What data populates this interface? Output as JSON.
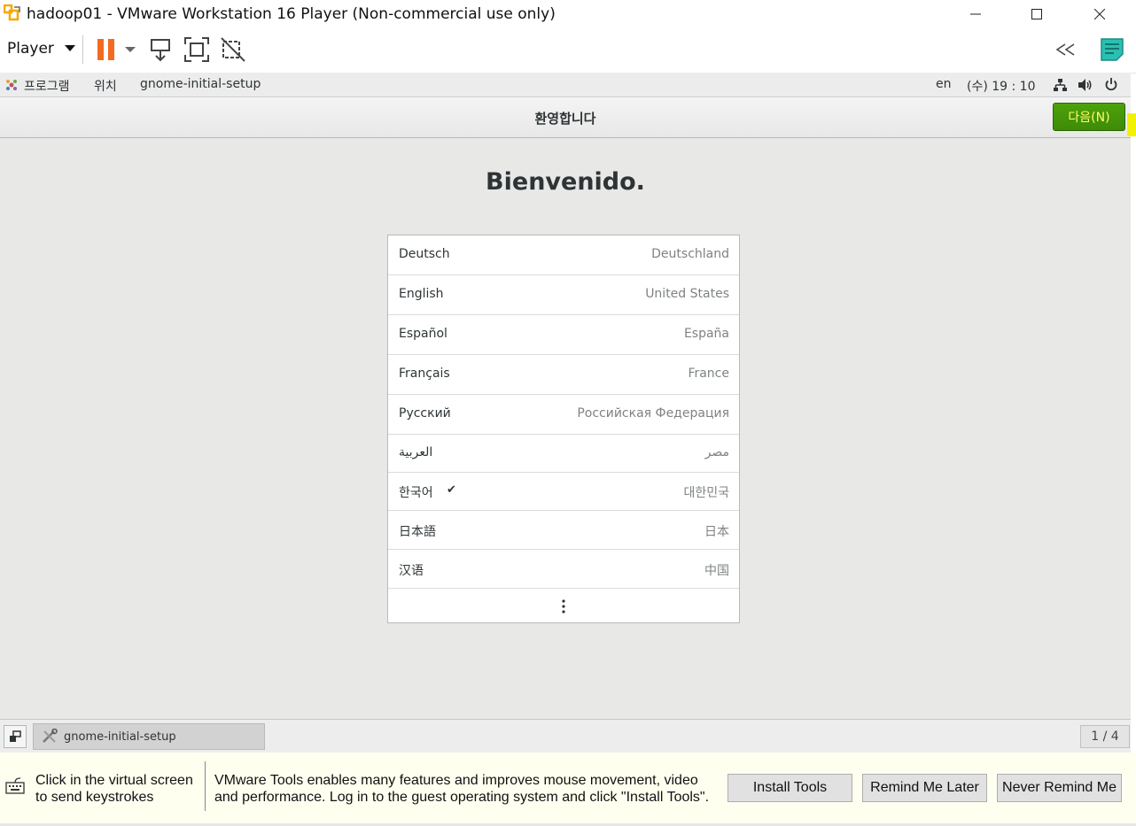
{
  "window": {
    "title": "hadoop01 - VMware Workstation 16 Player (Non-commercial use only)"
  },
  "toolbar": {
    "player_label": "Player"
  },
  "gnome_topbar": {
    "apps_label": "프로그램",
    "places_label": "위치",
    "app_name": "gnome-initial-setup",
    "keyboard_layout": "en",
    "clock": "(수) 19 : 10"
  },
  "header": {
    "title": "환영합니다",
    "next_label": "다음(N)"
  },
  "main": {
    "welcome": "Bienvenido.",
    "languages": [
      {
        "name": "Deutsch",
        "region": "Deutschland",
        "selected": false
      },
      {
        "name": "English",
        "region": "United States",
        "selected": false
      },
      {
        "name": "Español",
        "region": "España",
        "selected": false
      },
      {
        "name": "Français",
        "region": "France",
        "selected": false
      },
      {
        "name": "Русский",
        "region": "Российская Федерация",
        "selected": false
      },
      {
        "name": "العربية",
        "region": "مصر",
        "selected": false
      },
      {
        "name": "한국어",
        "region": "대한민국",
        "selected": true
      },
      {
        "name": "日本語",
        "region": "日本",
        "selected": false
      },
      {
        "name": "汉语",
        "region": "中国",
        "selected": false
      }
    ]
  },
  "taskbar": {
    "task_label": "gnome-initial-setup",
    "workspace": "1 / 4"
  },
  "notification": {
    "hint_line1": "Click in the virtual screen",
    "hint_line2": "to send keystrokes",
    "message_line1": "VMware Tools enables many features and improves mouse movement, video",
    "message_line2": "and performance. Log in to the guest operating system and click \"Install Tools\".",
    "install_label": "Install Tools",
    "remind_label": "Remind Me Later",
    "never_label": "Never Remind Me"
  },
  "colors": {
    "next_button": "#4ca20b",
    "pause_icon": "#f26b21",
    "accent_teal": "#2bbfb3"
  }
}
